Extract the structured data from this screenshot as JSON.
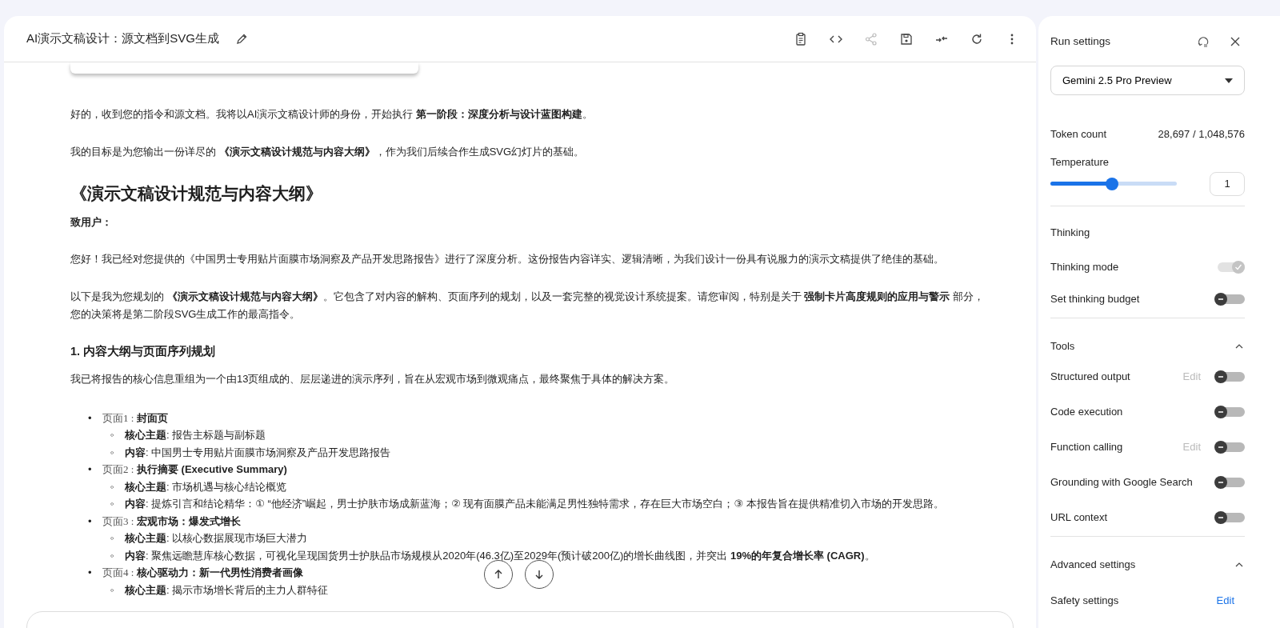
{
  "header": {
    "title": "AI演示文稿设计：源文档到SVG生成",
    "toolbar": [
      {
        "kind": "clipboard"
      },
      {
        "kind": "code"
      },
      {
        "kind": "share",
        "disabled": true
      },
      {
        "kind": "save"
      },
      {
        "kind": "compare"
      },
      {
        "kind": "refresh"
      },
      {
        "kind": "more"
      }
    ]
  },
  "message": {
    "blocks": [
      {
        "kind": "p",
        "text": "好的，收到您的指令和源文档。我将以AI演示文稿设计师的身份，开始执行 **第一阶段：深度分析与设计蓝图构建**。"
      },
      {
        "kind": "p",
        "text": "我的目标是为您输出一份详尽的 **《演示文稿设计规范与内容大纲》**，作为我们后续合作生成SVG幻灯片的基础。"
      },
      {
        "kind": "h2",
        "text": "《演示文稿设计规范与内容大纲》"
      },
      {
        "kind": "strong",
        "text": "致用户："
      },
      {
        "kind": "p",
        "text": "您好！我已经对您提供的《中国男士专用贴片面膜市场洞察及产品开发思路报告》进行了深度分析。这份报告内容详实、逻辑清晰，为我们设计一份具有说服力的演示文稿提供了绝佳的基础。"
      },
      {
        "kind": "p",
        "text": "以下是我为您规划的 **《演示文稿设计规范与内容大纲》**。它包含了对内容的解构、页面序列的规划，以及一套完整的视觉设计系统提案。请您审阅，特别是关于 **强制卡片高度规则的应用与警示** 部分，您的决策将是第二阶段SVG生成工作的最高指令。"
      },
      {
        "kind": "h3",
        "text": "1. 内容大纲与页面序列规划"
      },
      {
        "kind": "p",
        "text": "我已将报告的核心信息重组为一个由13页组成的、层层递进的演示序列，旨在从宏观市场到微观痛点，最终聚焦于具体的解决方案。"
      }
    ],
    "outline": [
      {
        "marker": "•",
        "page": "页面1 :",
        "title": "封面页",
        "children": [
          {
            "marker": "◦",
            "text": "**核心主题**: 报告主标题与副标题"
          },
          {
            "marker": "◦",
            "text": "**内容**: 中国男士专用贴片面膜市场洞察及产品开发思路报告"
          }
        ]
      },
      {
        "marker": "•",
        "page": "页面2 :",
        "title": "执行摘要 (Executive Summary)",
        "children": [
          {
            "marker": "◦",
            "text": "**核心主题**: 市场机遇与核心结论概览"
          },
          {
            "marker": "◦",
            "text": "**内容**: 提炼引言和结论精华：① “他经济”崛起，男士护肤市场成新蓝海；② 现有面膜产品未能满足男性独特需求，存在巨大市场空白；③ 本报告旨在提供精准切入市场的开发思路。"
          }
        ]
      },
      {
        "marker": "•",
        "page": "页面3 :",
        "title": "宏观市场：爆发式增长",
        "children": [
          {
            "marker": "◦",
            "text": "**核心主题**: 以核心数据展现市场巨大潜力"
          },
          {
            "marker": "◦",
            "text": "**内容**: 聚焦远瞻慧库核心数据，可视化呈现国货男士护肤品市场规模从2020年(46.3亿)至2029年(预计破200亿)的增长曲线图，并突出 **19%的年复合增长率 (CAGR)**。"
          }
        ]
      },
      {
        "marker": "•",
        "page": "页面4 :",
        "title": "核心驱动力：新一代男性消费者画像",
        "children": [
          {
            "marker": "◦",
            "text": "**核心主题**: 揭示市场增长背后的主力人群特征"
          }
        ]
      }
    ]
  },
  "settings": {
    "title": "Run settings",
    "model": "Gemini 2.5 Pro Preview",
    "token_label": "Token count",
    "token_value": "28,697 / 1,048,576",
    "temperature": {
      "label": "Temperature",
      "level": 0.49,
      "value": "1"
    },
    "sections": [
      {
        "title": "Thinking",
        "rows": [
          {
            "label": "Thinking mode",
            "on": true,
            "disabled": true
          },
          {
            "label": "Set thinking budget",
            "on": false,
            "disabled": false
          }
        ]
      },
      {
        "title": "Tools",
        "expanded": true,
        "rows": [
          {
            "label": "Structured output",
            "edit": "Edit",
            "on": false,
            "disabled": false
          },
          {
            "label": "Code execution",
            "on": false,
            "disabled": false
          },
          {
            "label": "Function calling",
            "edit": "Edit",
            "on": false,
            "disabled": false
          },
          {
            "label": "Grounding with Google Search",
            "on": false,
            "disabled": false
          },
          {
            "label": "URL context",
            "on": false,
            "disabled": false
          }
        ]
      },
      {
        "title": "Advanced settings",
        "expanded": true,
        "rows": [
          {
            "label": "Safety settings",
            "link": "Edit"
          }
        ]
      }
    ]
  }
}
